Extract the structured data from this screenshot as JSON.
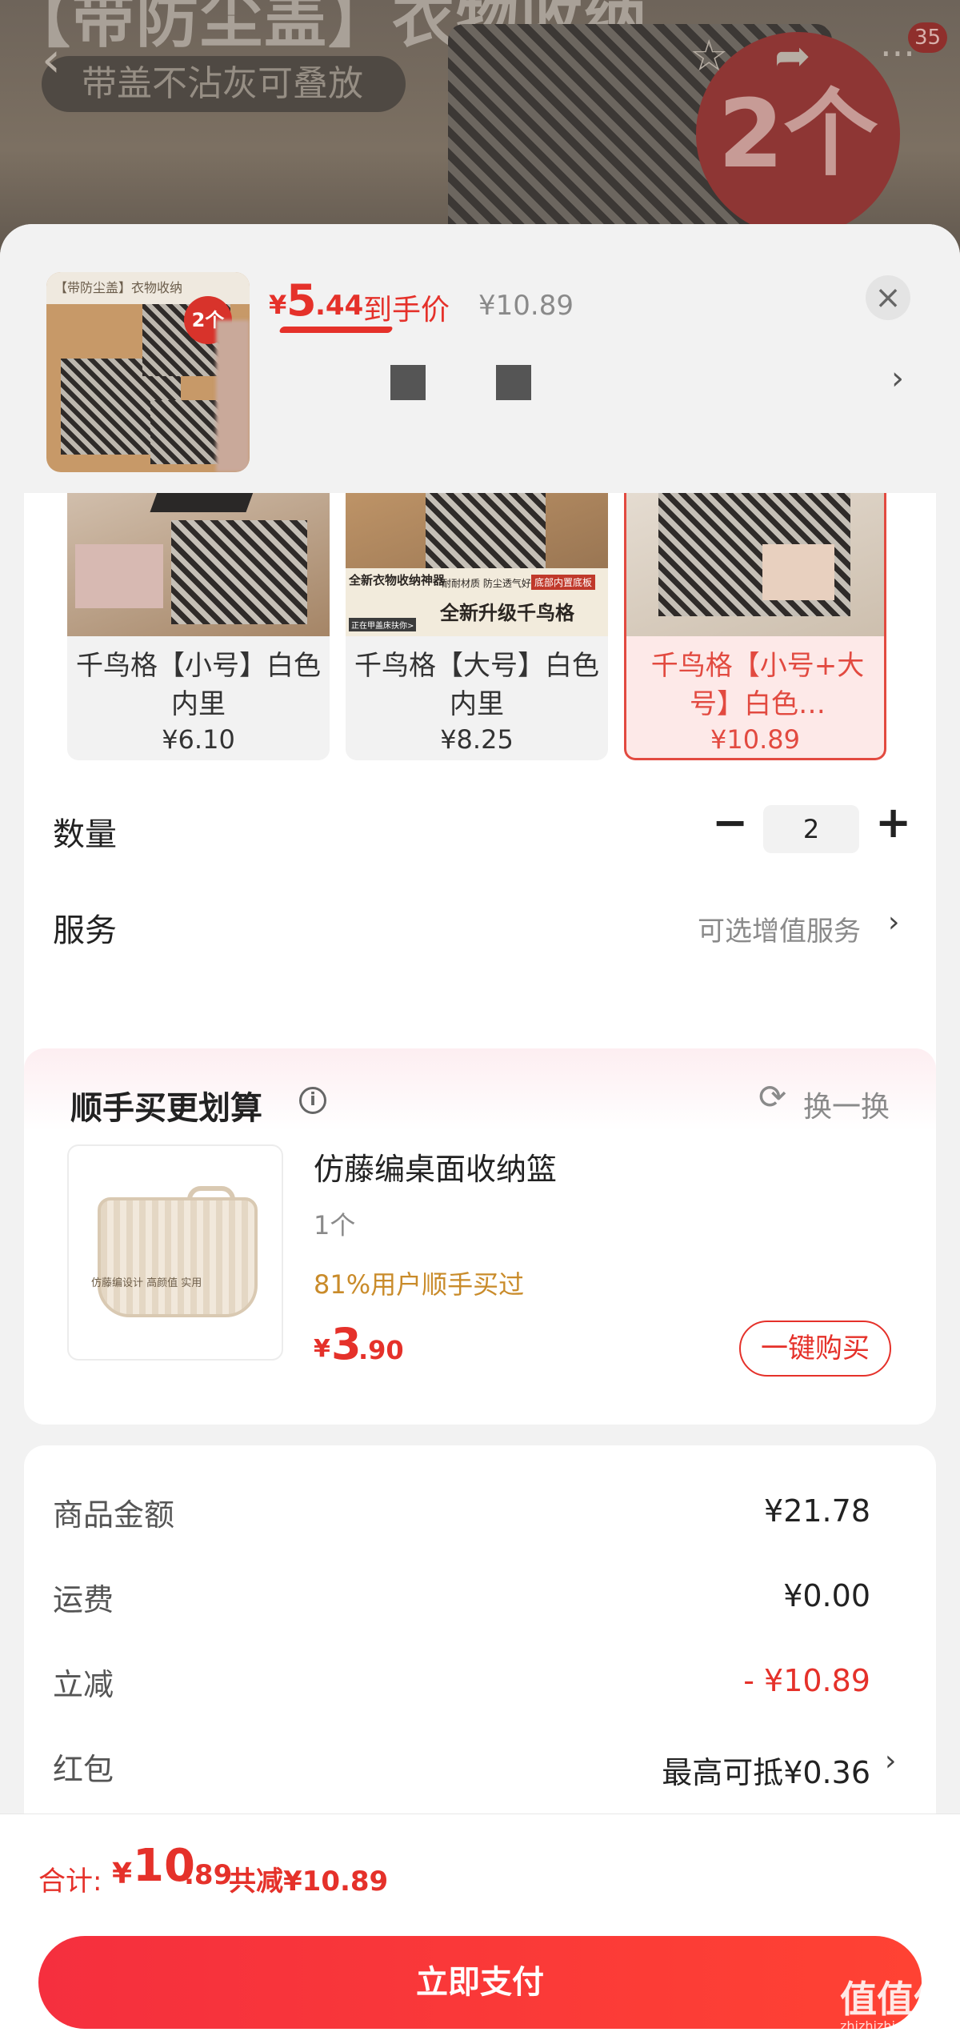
{
  "hero": {
    "title": "【带防尘盖】衣物收纳",
    "subtitle": "带盖不沾灰可叠放",
    "badge": "2个",
    "cart_count": "35",
    "back_icon": "back-arrow-icon",
    "fav_icon": "star-icon",
    "share_icon": "share-icon",
    "more_icon": "more-icon"
  },
  "header": {
    "thumb_top_text": "【带防尘盖】衣物收纳",
    "thumb_badge": "2个",
    "price_currency": "¥",
    "price_int": "5",
    "price_dec": ".44",
    "price_tag": "到手价",
    "original_price": "¥10.89",
    "close_glyph": "×",
    "next_glyph": "›"
  },
  "skus": [
    {
      "name": "千鸟格【小号】白色内里",
      "price": "¥6.10",
      "selected": false
    },
    {
      "name": "千鸟格【大号】白色内里",
      "price": "¥8.25",
      "selected": false
    },
    {
      "name": "千鸟格【小号+大号】白色…",
      "price": "¥10.89",
      "selected": true
    }
  ],
  "sku2_banner": {
    "a": "全新衣物收纳神器",
    "b": "耐耐材质 防尘透气好用",
    "c": "底部内置底板",
    "d": "全新升级千鸟格",
    "e": "正在甲盖床扶你>"
  },
  "quantity": {
    "label": "数量",
    "minus": "−",
    "value": "2",
    "plus": "+"
  },
  "service": {
    "label": "服务",
    "value": "可选增值服务",
    "chevron": "›"
  },
  "upsell": {
    "title": "顺手买更划算",
    "info_glyph": "i",
    "refresh_icon": "refresh-icon",
    "refresh_glyph": "⟳",
    "refresh_label": "换一换",
    "product_name": "仿藤编桌面收纳篮",
    "product_qty": "1个",
    "stat": "81%用户顺手买过",
    "price_currency": "¥",
    "price_int": "3",
    "price_dec": ".90",
    "buy_label": "一键购买",
    "thumb_text": "仿藤编设计 高颜值 实用"
  },
  "summary": [
    {
      "key": "商品金额",
      "value": "¥21.78",
      "red": false,
      "chevron": ""
    },
    {
      "key": "运费",
      "value": "¥0.00",
      "red": false,
      "chevron": ""
    },
    {
      "key": "立减",
      "value": "- ¥10.89",
      "red": true,
      "chevron": ""
    },
    {
      "key": "红包",
      "value": "最高可抵¥0.36",
      "red": false,
      "chevron": "›"
    }
  ],
  "footer": {
    "total_label": "合计:",
    "total_currency": "¥",
    "total_int": "10",
    "total_dec": ".89",
    "total_saving": "共减¥10.89",
    "pay_label": "立即支付"
  },
  "watermark": {
    "main": "值值值",
    "sub": "zhizhizhi.com"
  },
  "colors": {
    "accent": "#e5312a",
    "selected_bg": "#fde9e8",
    "upsell_stat": "#c98b2a"
  }
}
